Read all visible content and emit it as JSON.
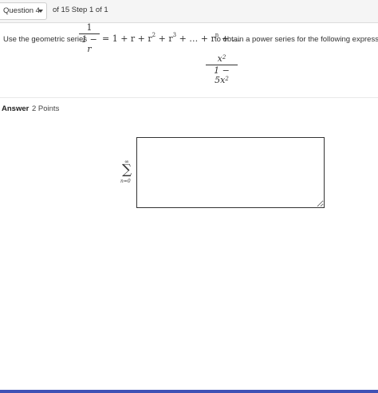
{
  "header": {
    "question_select_label": "Question 4",
    "step_text": "of 15 Step 1 of 1"
  },
  "prompt": {
    "lead": "Use the geometric series",
    "series_num": "1",
    "series_den": "1 − r",
    "series_rhs": "= 1 + r + r",
    "series_more": "+ r",
    "series_tail": "+ … + r",
    "series_end": "+ …",
    "tail": "to obtain a power series for the following expression.",
    "expr_num": "x",
    "expr_den": "1 − 5x",
    "exp2": "2",
    "exp3": "3",
    "expn": "n"
  },
  "answer": {
    "label": "Answer",
    "points": "2 Points",
    "sum_upper": "∞",
    "sum_symbol": "∑",
    "sum_lower": "n=0",
    "input_value": ""
  }
}
